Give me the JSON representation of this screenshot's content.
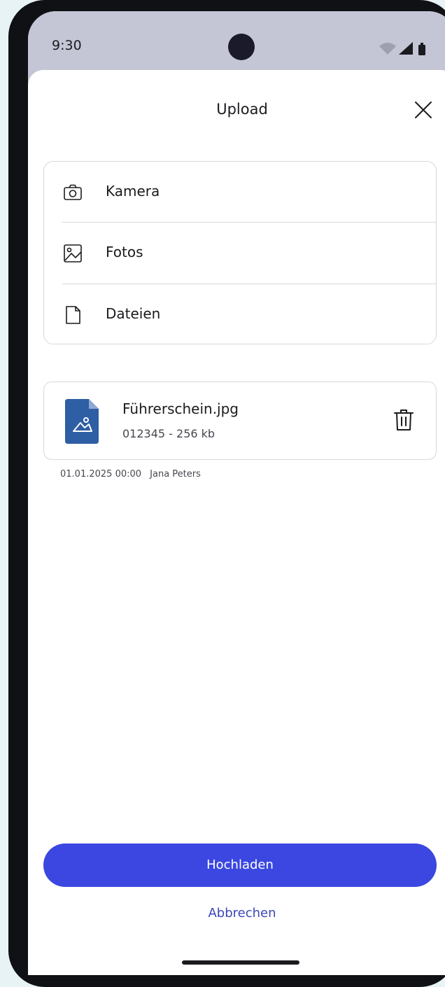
{
  "status_bar": {
    "time": "9:30"
  },
  "sheet": {
    "title": "Upload"
  },
  "options": [
    {
      "label": "Kamera",
      "icon": "camera-icon"
    },
    {
      "label": "Fotos",
      "icon": "image-icon"
    },
    {
      "label": "Dateien",
      "icon": "file-icon"
    }
  ],
  "file": {
    "name": "Führerschein.jpg",
    "meta": "012345 - 256 kb",
    "thumbnail_icon": "image-file-icon",
    "thumbnail_color": "#2e5ea3"
  },
  "upload_info": {
    "date": "01.01.2025 00:00",
    "user": "Jana Peters"
  },
  "actions": {
    "primary": "Hochladen",
    "secondary": "Abbrechen"
  },
  "colors": {
    "accent": "#3b47e0",
    "link": "#3b47b8",
    "status_bar": "#c4c6d6"
  }
}
